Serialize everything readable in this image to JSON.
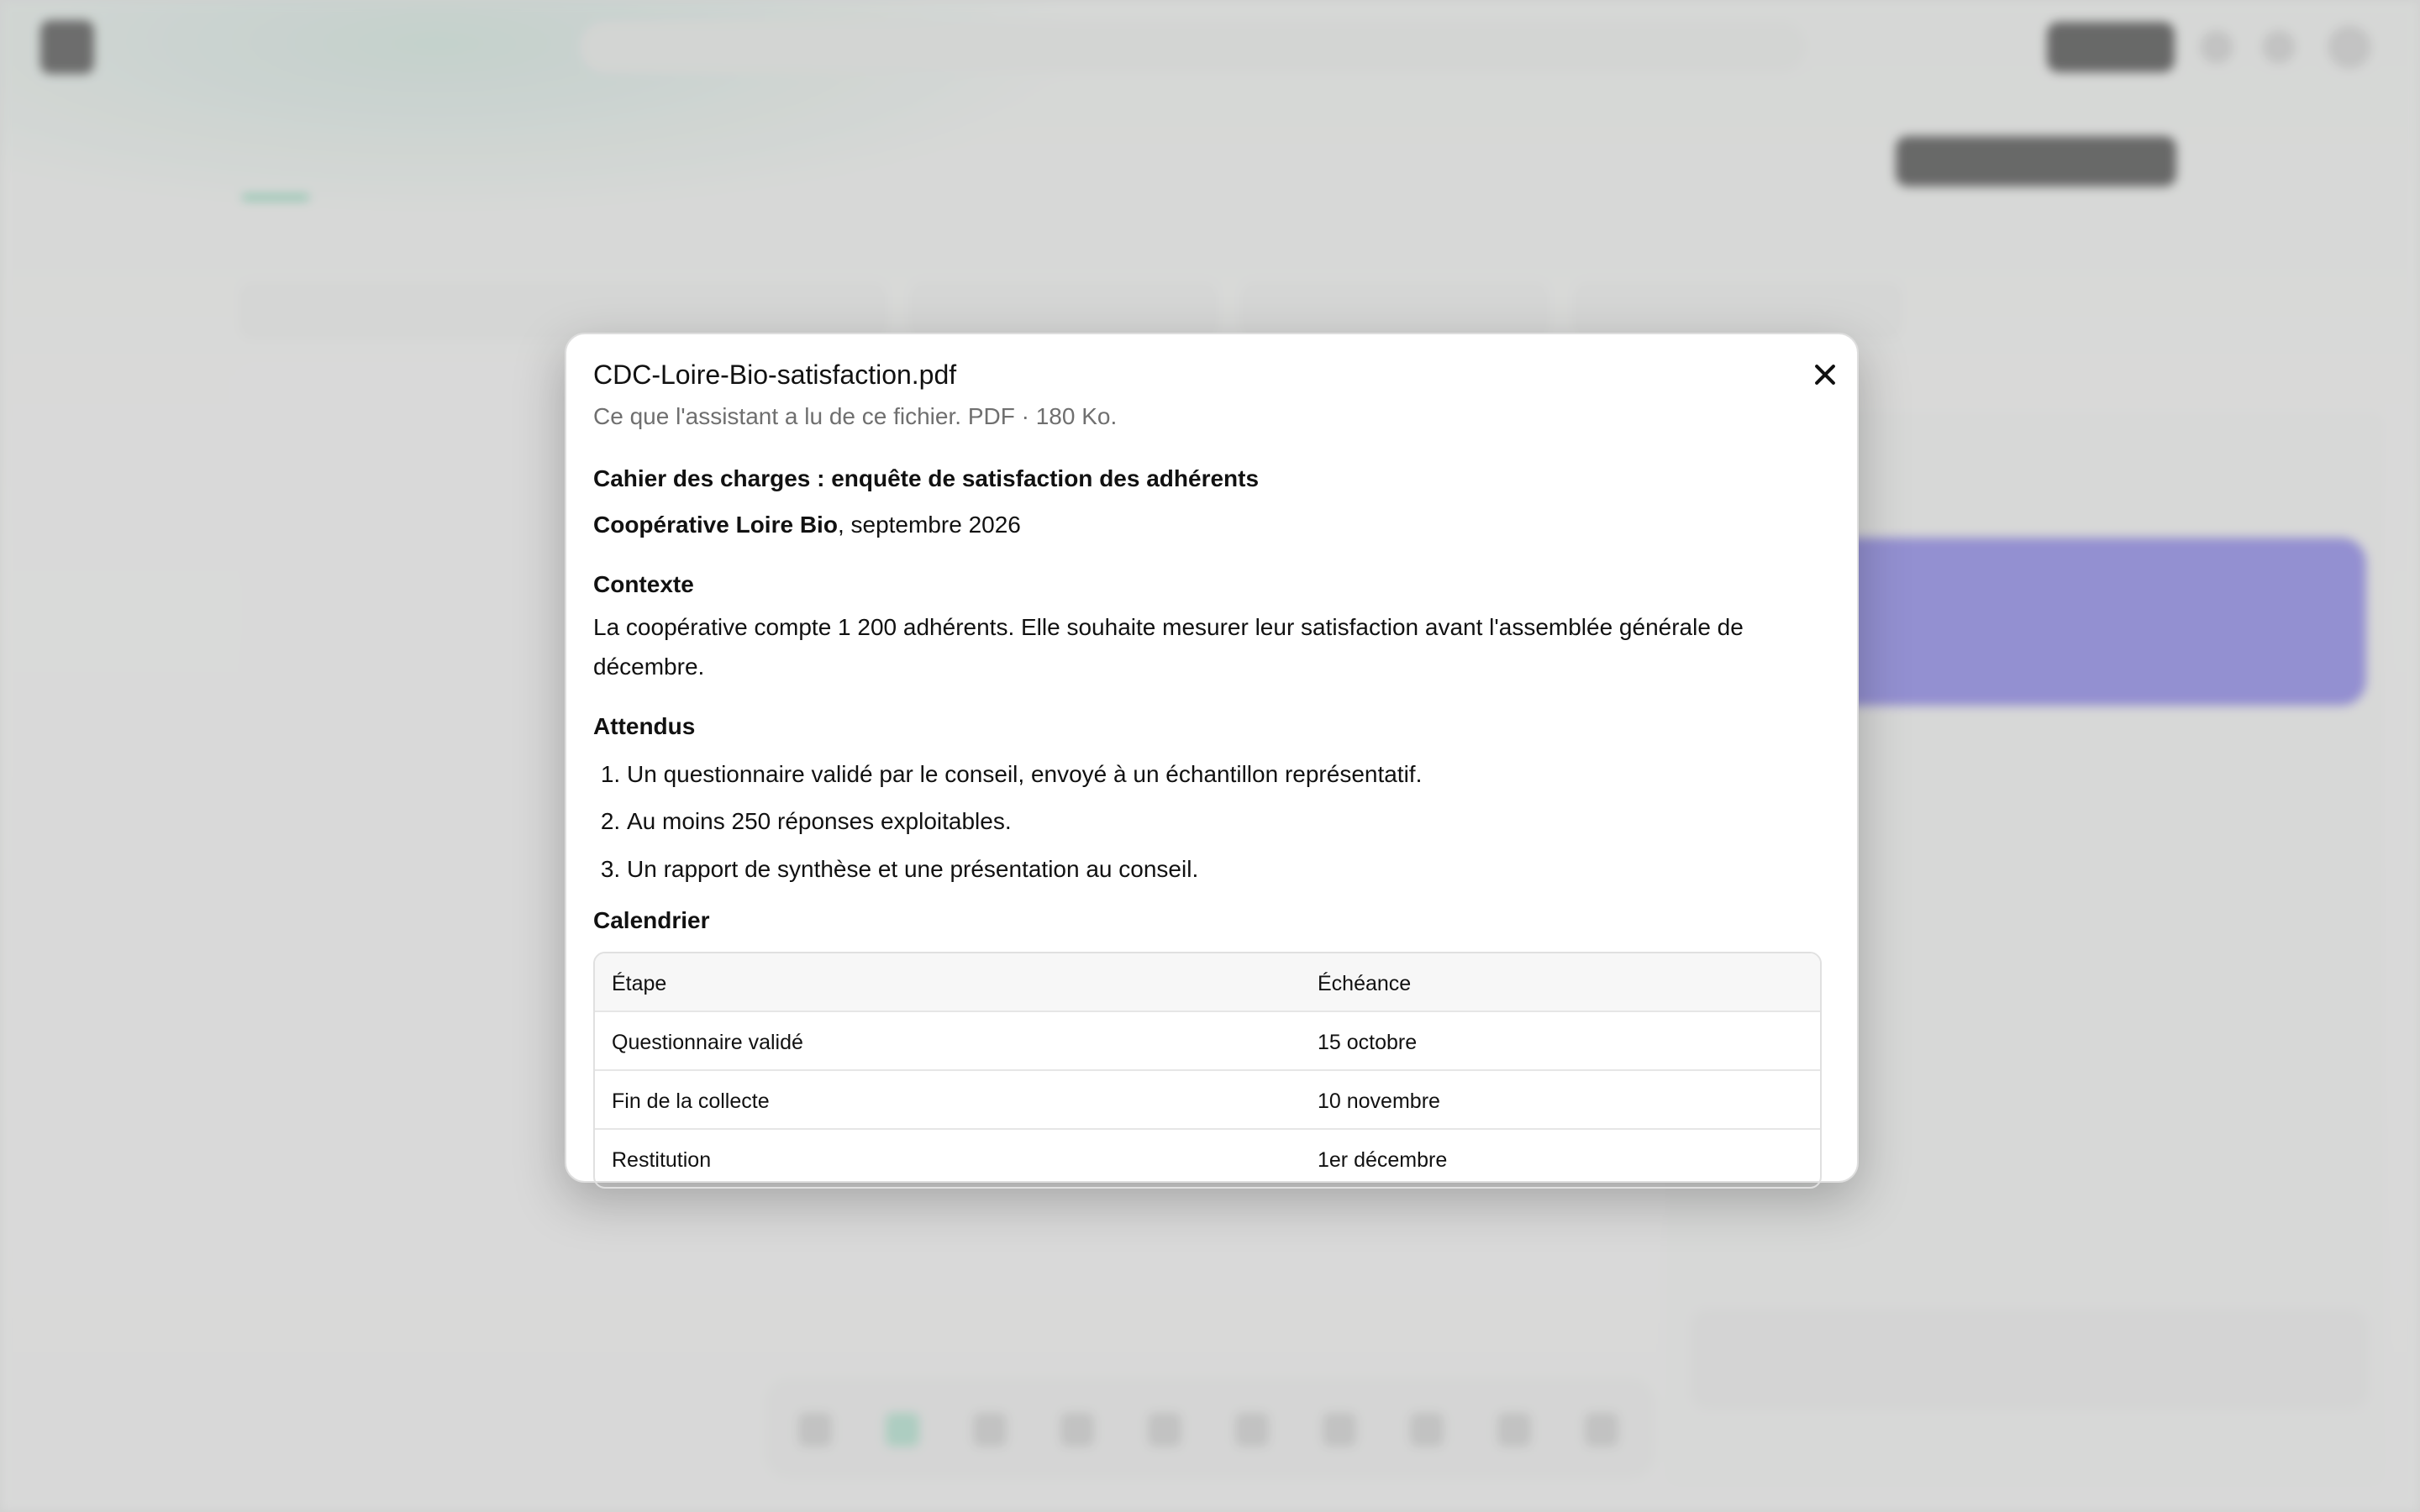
{
  "modal": {
    "title": "CDC-Loire-Bio-satisfaction.pdf",
    "subtitle": "Ce que l'assistant a lu de ce fichier. PDF · 180 Ko.",
    "document": {
      "heading": "Cahier des charges : enquête de satisfaction des adhérents",
      "client_bold": "Coopérative Loire Bio",
      "client_rest": ", septembre 2026",
      "context_title": "Contexte",
      "context_text": "La coopérative compte 1 200 adhérents. Elle souhaite mesurer leur satisfaction avant l'assemblée générale de décembre.",
      "deliverables_title": "Attendus",
      "deliverables": [
        "Un questionnaire validé par le conseil, envoyé à un échantillon représentatif.",
        "Au moins 250 réponses exploitables.",
        "Un rapport de synthèse et une présentation au conseil."
      ],
      "calendar_title": "Calendrier",
      "calendar_headers": [
        "Étape",
        "Échéance"
      ],
      "calendar_rows": [
        [
          "Questionnaire validé",
          "15 octobre"
        ],
        [
          "Fin de la collecte",
          "10 novembre"
        ],
        [
          "Restitution",
          "1er décembre"
        ]
      ]
    }
  }
}
